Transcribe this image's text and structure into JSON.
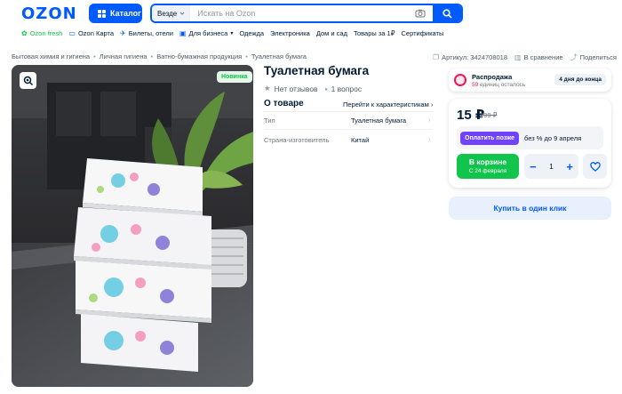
{
  "header": {
    "logo": "OZON",
    "catalog_label": "Каталог",
    "search_scope": "Везде",
    "search_placeholder": "Искать на Ozon"
  },
  "nav": [
    {
      "label": "Ozon fresh",
      "icon": "leaf-icon"
    },
    {
      "label": "Ozon Карта",
      "icon": "card-icon"
    },
    {
      "label": "Билеты, отели",
      "icon": "plane-icon"
    },
    {
      "label": "Для бизнеса",
      "icon": "briefcase-icon"
    },
    {
      "label": "Одежда"
    },
    {
      "label": "Электроника"
    },
    {
      "label": "Дом и сад"
    },
    {
      "label": "Товары за 1₽"
    },
    {
      "label": "Сертификаты"
    }
  ],
  "breadcrumb": [
    "Бытовая химия и гигиена",
    "Личная гигиена",
    "Ватно-бумажная продукция",
    "Туалетная бумага"
  ],
  "breadcrumb_sep": "•",
  "article": {
    "label": "Артикул: 3424708018",
    "compare": "В сравнение",
    "share": "Поделиться"
  },
  "product": {
    "badge": "Новинка",
    "title": "Туалетная бумага",
    "reviews": "Нет отзывов",
    "questions": "1 вопрос"
  },
  "about": {
    "title": "О товаре",
    "to_chars": "Перейти к характеристикам",
    "specs": [
      {
        "key": "Тип",
        "value": "Туалетная бумага"
      },
      {
        "key": "Страна-изготовитель",
        "value": "Китай"
      }
    ]
  },
  "sale": {
    "title": "Распродажа",
    "units": "59",
    "units_suffix": "единиц осталось",
    "days": "4 дня до конца"
  },
  "buy": {
    "price": "15 ₽",
    "old_price": "109 ₽",
    "installment_btn": "Оплатить позже",
    "installment_text": "без % до 9 апреля",
    "cart_label": "В корзине",
    "cart_date": "С 24 февраля",
    "qty": "1",
    "minus": "−",
    "plus": "+",
    "one_click": "Купить в один клик"
  },
  "colors": {
    "brand": "#005bff",
    "green": "#10c44c",
    "sale": "#f91155",
    "installment": "#6f42ff"
  }
}
